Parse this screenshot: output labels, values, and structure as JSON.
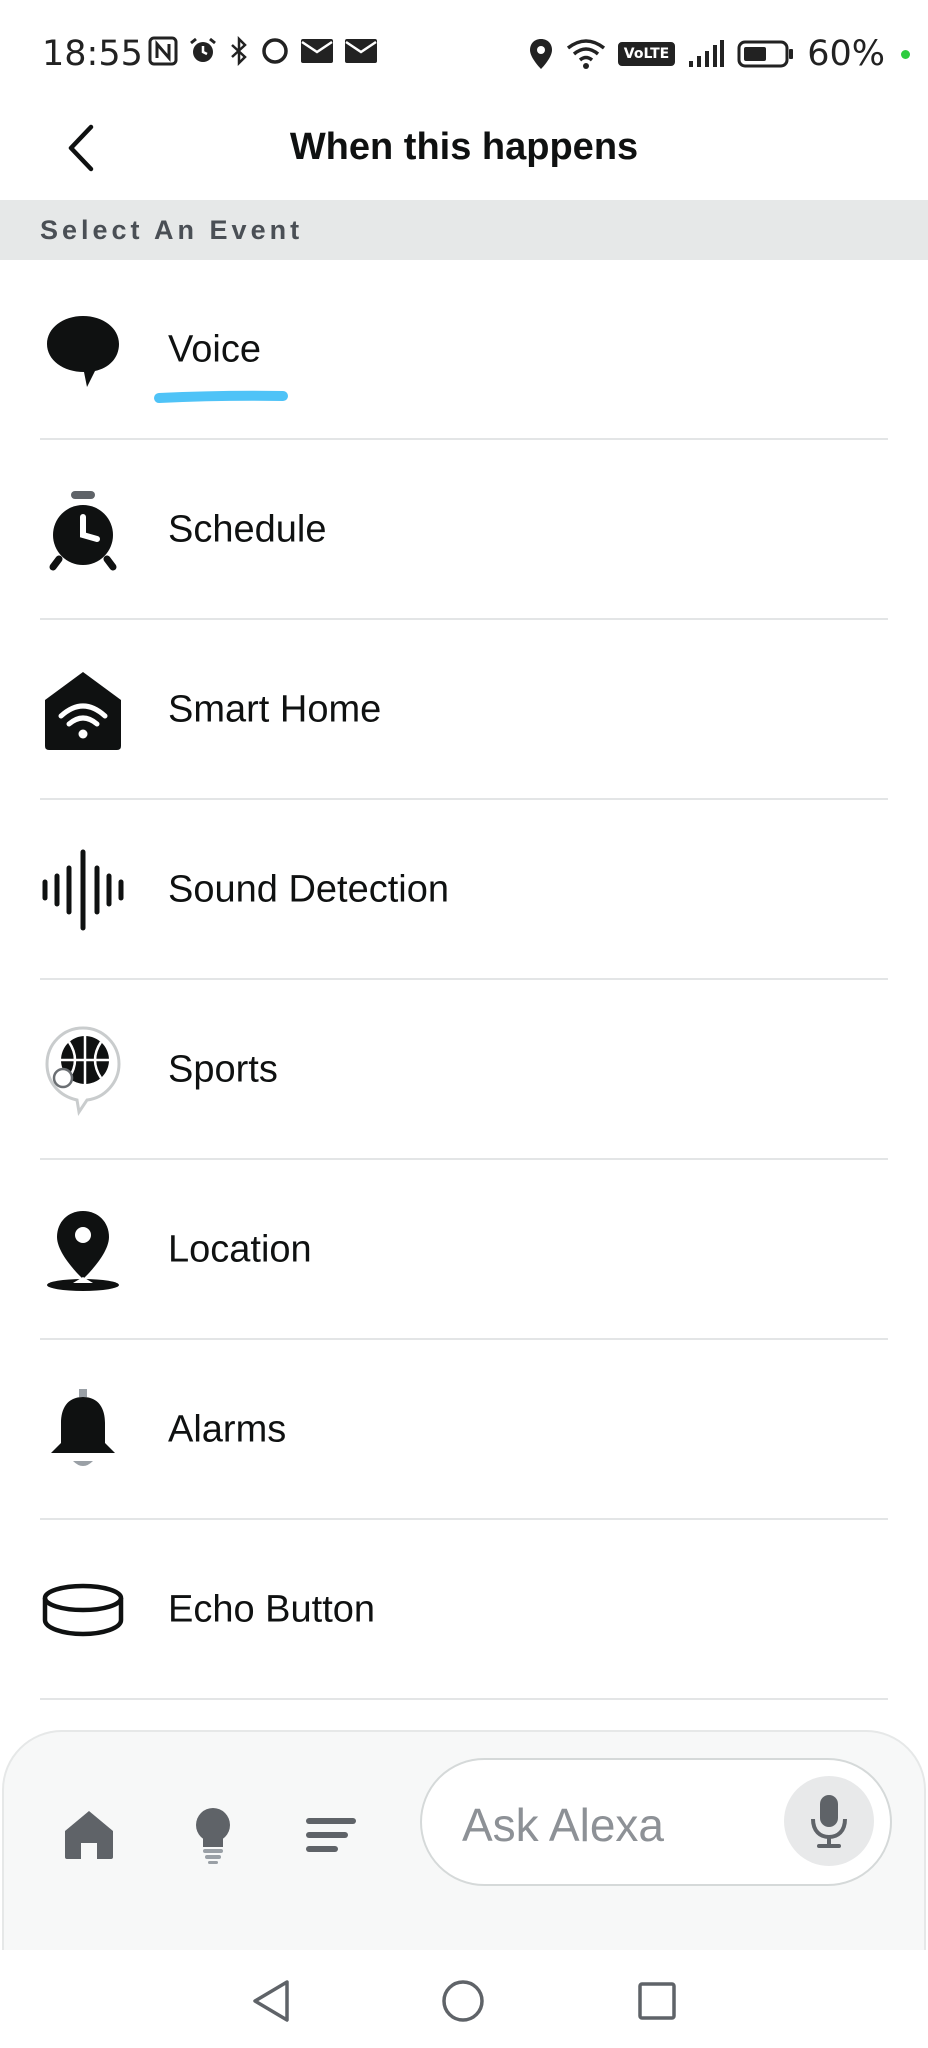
{
  "status_bar": {
    "time": "18:55",
    "battery_percent": "60%",
    "volte_label": "VoLTE",
    "icons": [
      "nfc-icon",
      "alarm-icon",
      "bluetooth-icon",
      "circle-icon",
      "mail-icon",
      "mail-icon",
      "location-icon",
      "wifi-icon",
      "volte-icon",
      "signal-icon",
      "battery-icon"
    ]
  },
  "header": {
    "title": "When this happens",
    "back_icon": "chevron-left-icon"
  },
  "section": {
    "label": "Select An Event"
  },
  "events": [
    {
      "label": "Voice",
      "icon": "speech-bubble-icon"
    },
    {
      "label": "Schedule",
      "icon": "alarm-clock-icon"
    },
    {
      "label": "Smart Home",
      "icon": "smart-home-icon"
    },
    {
      "label": "Sound Detection",
      "icon": "sound-wave-icon"
    },
    {
      "label": "Sports",
      "icon": "sports-ball-icon"
    },
    {
      "label": "Location",
      "icon": "location-pin-icon"
    },
    {
      "label": "Alarms",
      "icon": "bell-icon"
    },
    {
      "label": "Echo Button",
      "icon": "echo-button-icon"
    }
  ],
  "bottom_nav": {
    "ask_placeholder": "Ask Alexa",
    "icons": [
      "home-icon",
      "lightbulb-icon",
      "list-icon",
      "microphone-icon"
    ]
  },
  "colors": {
    "accent_underline": "#4fc3f7",
    "section_bg": "#e6e8e8"
  }
}
